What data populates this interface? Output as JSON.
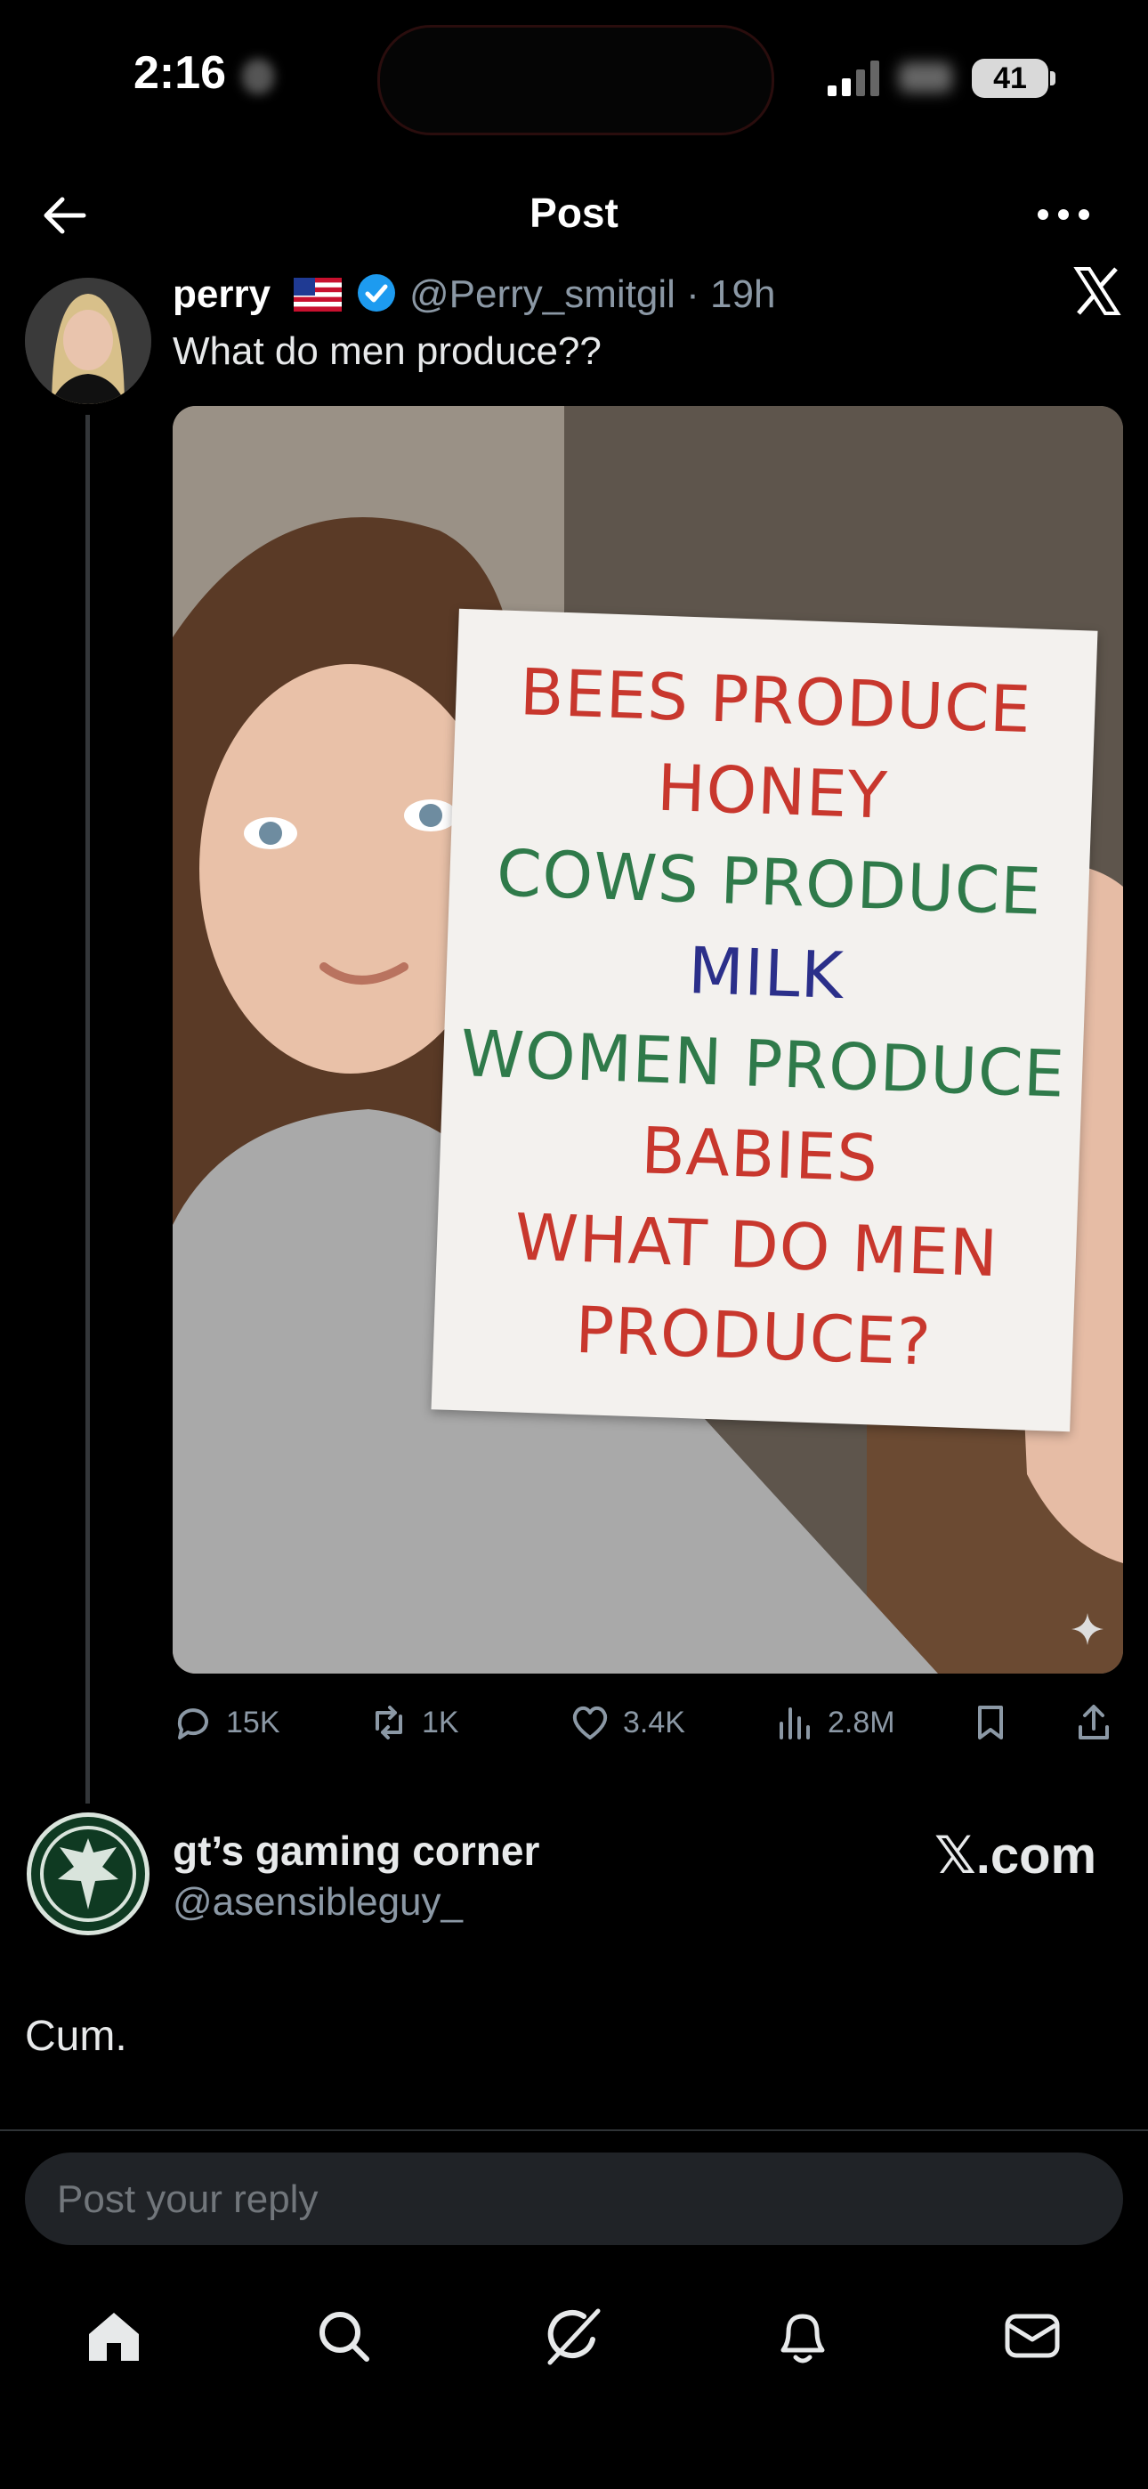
{
  "status_bar": {
    "time": "2:16",
    "battery": "41"
  },
  "header": {
    "title": "Post",
    "back_icon": "arrow-left-icon",
    "more_icon": "ellipsis-icon"
  },
  "tweet": {
    "author_name": "perry",
    "handle_time": "@Perry_smitgil · 19h",
    "text": "What do men produce??",
    "sign_lines": [
      {
        "text": "BEES PRODUCE",
        "color": "#c8372d"
      },
      {
        "text": "HONEY",
        "color": "#c8372d"
      },
      {
        "text": "COWS PRODUCE",
        "color": "#2f7a4a"
      },
      {
        "text": "MILK",
        "color": "#2b2f8a"
      },
      {
        "text": "WOMEN PRODUCE",
        "color": "#2f7a4a"
      },
      {
        "text": "BABIES",
        "color": "#c8372d"
      },
      {
        "text": "WHAT DO MEN",
        "color": "#c8372d"
      },
      {
        "text": "PRODUCE?",
        "color": "#c8372d"
      }
    ],
    "actions": {
      "replies": "15K",
      "reposts": "1K",
      "likes": "3.4K",
      "views": "2.8M"
    }
  },
  "reply": {
    "name": "gt’s gaming corner",
    "handle": "@asensibleguy_",
    "watermark": "𝕏.com",
    "text": "Cum."
  },
  "composer": {
    "placeholder": "Post your reply"
  },
  "colors": {
    "background": "#000000",
    "verified": "#1d9bf0",
    "muted": "#8b98a5"
  }
}
